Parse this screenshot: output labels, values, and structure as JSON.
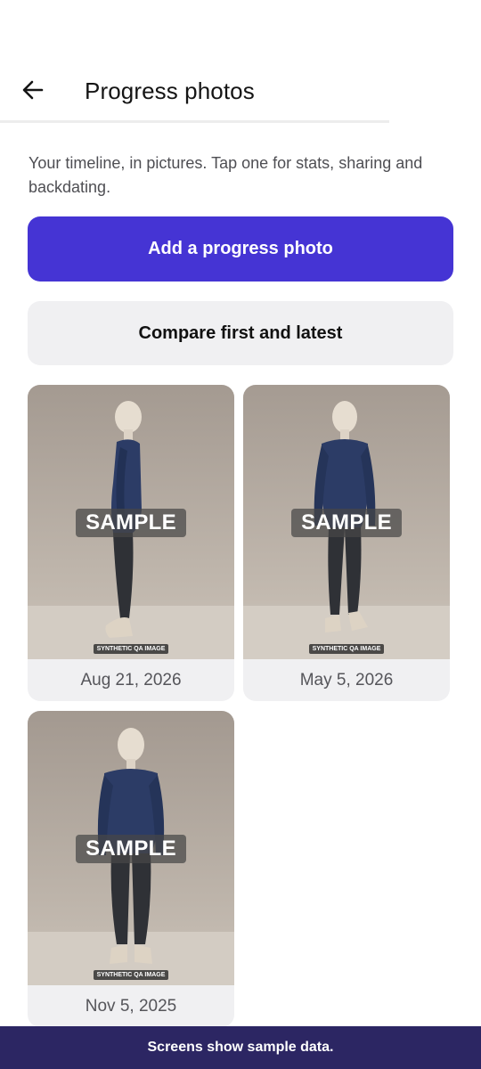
{
  "header": {
    "title": "Progress photos",
    "back_icon": "arrow-left-icon"
  },
  "subtitle": "Your timeline, in pictures. Tap one for stats, sharing and backdating.",
  "actions": {
    "add_label": "Add a progress photo",
    "compare_label": "Compare first and latest"
  },
  "colors": {
    "primary": "#4534d4",
    "secondary_bg": "#f0f0f2",
    "footer_bg": "#2c2663"
  },
  "photos": [
    {
      "date": "Aug 21, 2026",
      "watermark": "SAMPLE",
      "tag": "SYNTHETIC QA IMAGE",
      "pose": "side"
    },
    {
      "date": "May 5, 2026",
      "watermark": "SAMPLE",
      "tag": "SYNTHETIC QA IMAGE",
      "pose": "front"
    },
    {
      "date": "Nov 5, 2025",
      "watermark": "SAMPLE",
      "tag": "SYNTHETIC QA IMAGE",
      "pose": "front"
    }
  ],
  "footer": {
    "notice": "Screens show sample data."
  }
}
